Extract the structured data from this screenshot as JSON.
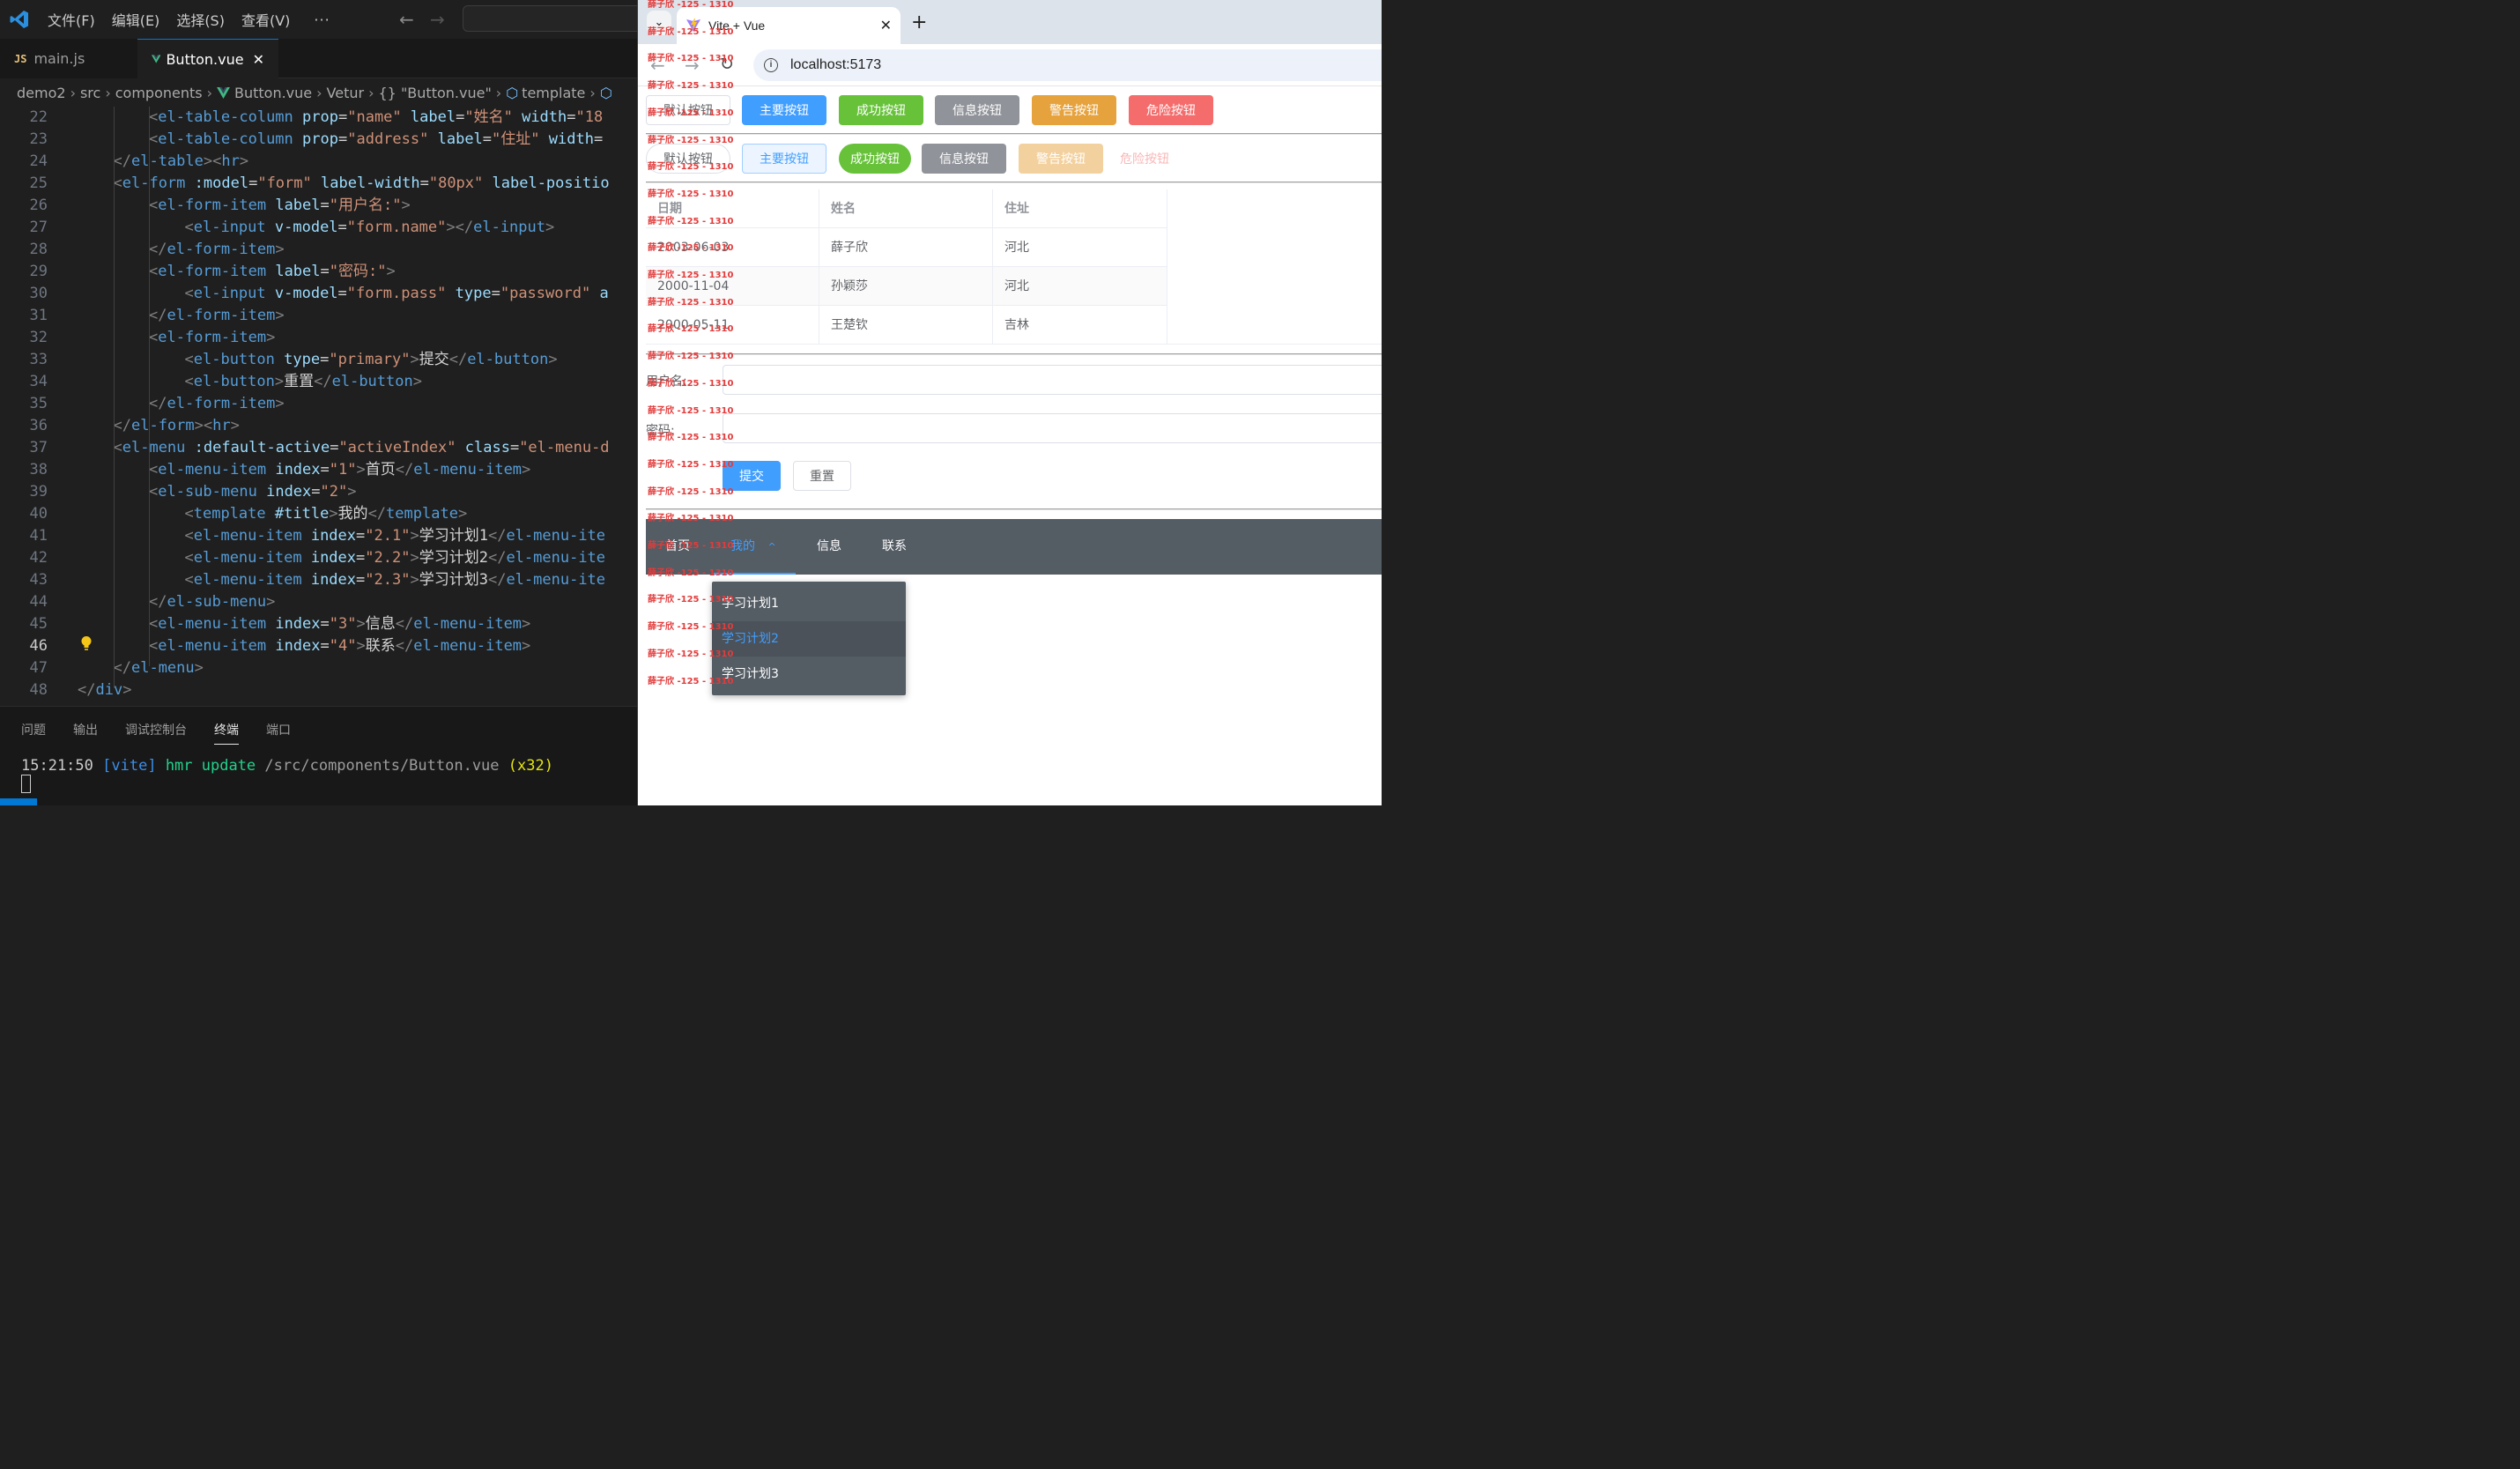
{
  "vscode": {
    "menu": [
      "文件(F)",
      "编辑(E)",
      "选择(S)",
      "查看(V)"
    ],
    "menu_more": "···",
    "tabs": [
      {
        "label": "main.js",
        "badge": "JS"
      },
      {
        "label": "Button.vue"
      }
    ],
    "breadcrumb": [
      "demo2",
      "src",
      "components",
      "Button.vue",
      "Vetur",
      "{} \"Button.vue\"",
      "template"
    ],
    "code_lines": [
      {
        "n": "22",
        "html": "<span class='t-bracket'>&lt;</span><span class='t-tag'>el-table-column</span> <span class='t-attr'>prop</span>=<span class='t-str'>\"name\"</span> <span class='t-attr'>label</span>=<span class='t-str'>\"姓名\"</span> <span class='t-attr'>width</span>=<span class='t-str'>\"18</span>",
        "indent": 5
      },
      {
        "n": "23",
        "html": "<span class='t-bracket'>&lt;</span><span class='t-tag'>el-table-column</span> <span class='t-attr'>prop</span>=<span class='t-str'>\"address\"</span> <span class='t-attr'>label</span>=<span class='t-str'>\"住址\"</span> <span class='t-attr'>width</span>=",
        "indent": 5
      },
      {
        "n": "24",
        "html": "<span class='t-bracket'>&lt;/</span><span class='t-tag'>el-table</span><span class='t-bracket'>&gt;&lt;</span><span class='t-tag'>hr</span><span class='t-bracket'>&gt;</span>",
        "indent": 4
      },
      {
        "n": "25",
        "html": "<span class='t-bracket'>&lt;</span><span class='t-tag'>el-form</span> <span class='t-attr'>:model</span>=<span class='t-str'>\"form\"</span> <span class='t-attr'>label-width</span>=<span class='t-str'>\"80px\"</span> <span class='t-attr'>label-positio</span>",
        "indent": 4
      },
      {
        "n": "26",
        "html": "<span class='t-bracket'>&lt;</span><span class='t-tag'>el-form-item</span> <span class='t-attr'>label</span>=<span class='t-str'>\"用户名:\"</span><span class='t-bracket'>&gt;</span>",
        "indent": 5
      },
      {
        "n": "27",
        "html": "<span class='t-bracket'>&lt;</span><span class='t-tag'>el-input</span> <span class='t-attr'>v-model</span>=<span class='t-str'>\"form.name\"</span><span class='t-bracket'>&gt;&lt;/</span><span class='t-tag'>el-input</span><span class='t-bracket'>&gt;</span>",
        "indent": 6
      },
      {
        "n": "28",
        "html": "<span class='t-bracket'>&lt;/</span><span class='t-tag'>el-form-item</span><span class='t-bracket'>&gt;</span>",
        "indent": 5
      },
      {
        "n": "29",
        "html": "<span class='t-bracket'>&lt;</span><span class='t-tag'>el-form-item</span> <span class='t-attr'>label</span>=<span class='t-str'>\"密码:\"</span><span class='t-bracket'>&gt;</span>",
        "indent": 5
      },
      {
        "n": "30",
        "html": "<span class='t-bracket'>&lt;</span><span class='t-tag'>el-input</span> <span class='t-attr'>v-model</span>=<span class='t-str'>\"form.pass\"</span> <span class='t-attr'>type</span>=<span class='t-str'>\"password\"</span> <span class='t-attr'>a</span>",
        "indent": 6
      },
      {
        "n": "31",
        "html": "<span class='t-bracket'>&lt;/</span><span class='t-tag'>el-form-item</span><span class='t-bracket'>&gt;</span>",
        "indent": 5
      },
      {
        "n": "32",
        "html": "<span class='t-bracket'>&lt;</span><span class='t-tag'>el-form-item</span><span class='t-bracket'>&gt;</span>",
        "indent": 5
      },
      {
        "n": "33",
        "html": "<span class='t-bracket'>&lt;</span><span class='t-tag'>el-button</span> <span class='t-attr'>type</span>=<span class='t-str'>\"primary\"</span><span class='t-bracket'>&gt;</span>提交<span class='t-bracket'>&lt;/</span><span class='t-tag'>el-button</span><span class='t-bracket'>&gt;</span>",
        "indent": 6
      },
      {
        "n": "34",
        "html": "<span class='t-bracket'>&lt;</span><span class='t-tag'>el-button</span><span class='t-bracket'>&gt;</span>重置<span class='t-bracket'>&lt;/</span><span class='t-tag'>el-button</span><span class='t-bracket'>&gt;</span>",
        "indent": 6
      },
      {
        "n": "35",
        "html": "<span class='t-bracket'>&lt;/</span><span class='t-tag'>el-form-item</span><span class='t-bracket'>&gt;</span>",
        "indent": 5
      },
      {
        "n": "36",
        "html": "<span class='t-bracket'>&lt;/</span><span class='t-tag'>el-form</span><span class='t-bracket'>&gt;&lt;</span><span class='t-tag'>hr</span><span class='t-bracket'>&gt;</span>",
        "indent": 4
      },
      {
        "n": "37",
        "html": "<span class='t-bracket'>&lt;</span><span class='t-tag'>el-menu</span> <span class='t-attr'>:default-active</span>=<span class='t-str'>\"activeIndex\"</span> <span class='t-attr'>class</span>=<span class='t-str'>\"el-menu-d</span>",
        "indent": 4
      },
      {
        "n": "38",
        "html": "<span class='t-bracket'>&lt;</span><span class='t-tag'>el-menu-item</span> <span class='t-attr'>index</span>=<span class='t-str'>\"1\"</span><span class='t-bracket'>&gt;</span>首页<span class='t-bracket'>&lt;/</span><span class='t-tag'>el-menu-item</span><span class='t-bracket'>&gt;</span>",
        "indent": 5
      },
      {
        "n": "39",
        "html": "<span class='t-bracket'>&lt;</span><span class='t-tag'>el-sub-menu</span> <span class='t-attr'>index</span>=<span class='t-str'>\"2\"</span><span class='t-bracket'>&gt;</span>",
        "indent": 5
      },
      {
        "n": "40",
        "html": "<span class='t-bracket'>&lt;</span><span class='t-tag'>template</span> <span class='t-attr'>#title</span><span class='t-bracket'>&gt;</span>我的<span class='t-bracket'>&lt;/</span><span class='t-tag'>template</span><span class='t-bracket'>&gt;</span>",
        "indent": 6
      },
      {
        "n": "41",
        "html": "<span class='t-bracket'>&lt;</span><span class='t-tag'>el-menu-item</span> <span class='t-attr'>index</span>=<span class='t-str'>\"2.1\"</span><span class='t-bracket'>&gt;</span>学习计划1<span class='t-bracket'>&lt;/</span><span class='t-tag'>el-menu-ite</span>",
        "indent": 6
      },
      {
        "n": "42",
        "html": "<span class='t-bracket'>&lt;</span><span class='t-tag'>el-menu-item</span> <span class='t-attr'>index</span>=<span class='t-str'>\"2.2\"</span><span class='t-bracket'>&gt;</span>学习计划2<span class='t-bracket'>&lt;/</span><span class='t-tag'>el-menu-ite</span>",
        "indent": 6
      },
      {
        "n": "43",
        "html": "<span class='t-bracket'>&lt;</span><span class='t-tag'>el-menu-item</span> <span class='t-attr'>index</span>=<span class='t-str'>\"2.3\"</span><span class='t-bracket'>&gt;</span>学习计划3<span class='t-bracket'>&lt;/</span><span class='t-tag'>el-menu-ite</span>",
        "indent": 6
      },
      {
        "n": "44",
        "html": "<span class='t-bracket'>&lt;/</span><span class='t-tag'>el-sub-menu</span><span class='t-bracket'>&gt;</span>",
        "indent": 5
      },
      {
        "n": "45",
        "html": "<span class='t-bracket'>&lt;</span><span class='t-tag'>el-menu-item</span> <span class='t-attr'>index</span>=<span class='t-str'>\"3\"</span><span class='t-bracket'>&gt;</span>信息<span class='t-bracket'>&lt;/</span><span class='t-tag'>el-menu-item</span><span class='t-bracket'>&gt;</span>",
        "indent": 5
      },
      {
        "n": "46",
        "html": "<span class='t-bracket'>&lt;</span><span class='t-tag'>el-menu-item</span> <span class='t-attr'>index</span>=<span class='t-str'>\"4\"</span><span class='t-bracket'>&gt;</span>联系<span class='t-bracket'>&lt;/</span><span class='t-tag'>el-menu-item</span><span class='t-bracket'>&gt;</span>",
        "indent": 5
      },
      {
        "n": "47",
        "html": "<span class='t-bracket'>&lt;/</span><span class='t-tag'>el-menu</span><span class='t-bracket'>&gt;</span>",
        "indent": 4
      },
      {
        "n": "48",
        "html": "<span class='t-bracket'>&lt;/</span><span class='t-tag'>div</span><span class='t-bracket'>&gt;</span>",
        "indent": 3
      }
    ],
    "active_line": "46",
    "panel_tabs": [
      "问题",
      "输出",
      "调试控制台",
      "终端",
      "端口"
    ],
    "terminal": {
      "time": "15:21:50",
      "tag": "[vite]",
      "msg": "hmr update",
      "path": "/src/components/Button.vue",
      "count": "(x32)"
    }
  },
  "browser": {
    "tab_title": "Vite + Vue",
    "url": "localhost:5173",
    "buttons_row1": [
      "默认按钮",
      "主要按钮",
      "成功按钮",
      "信息按钮",
      "警告按钮",
      "危险按钮"
    ],
    "buttons_row2": [
      "默认按钮",
      "主要按钮",
      "成功按钮",
      "信息按钮",
      "警告按钮",
      "危险按钮"
    ],
    "table": {
      "headers": [
        "日期",
        "姓名",
        "住址"
      ],
      "rows": [
        [
          "2003-06-03",
          "薛子欣",
          "河北"
        ],
        [
          "2000-11-04",
          "孙颖莎",
          "河北"
        ],
        [
          "2000-05-11",
          "王楚钦",
          "吉林"
        ]
      ]
    },
    "form": {
      "name_label": "用户名:",
      "pass_label": "密码:",
      "submit": "提交",
      "reset": "重置"
    },
    "menu": {
      "items": [
        "首页",
        "我的",
        "信息",
        "联系"
      ],
      "sub_items": [
        "学习计划1",
        "学习计划2",
        "学习计划3"
      ],
      "submenu_arrow": "^"
    },
    "watermark": "薛子欣 -125 - 1310"
  },
  "colors": {
    "primary": "#409eff",
    "success": "#67c23a",
    "info": "#909399",
    "warning": "#e6a23c",
    "danger": "#f56c6c",
    "menu_bg": "#545c64",
    "vscode_accent": "#0078d4"
  }
}
